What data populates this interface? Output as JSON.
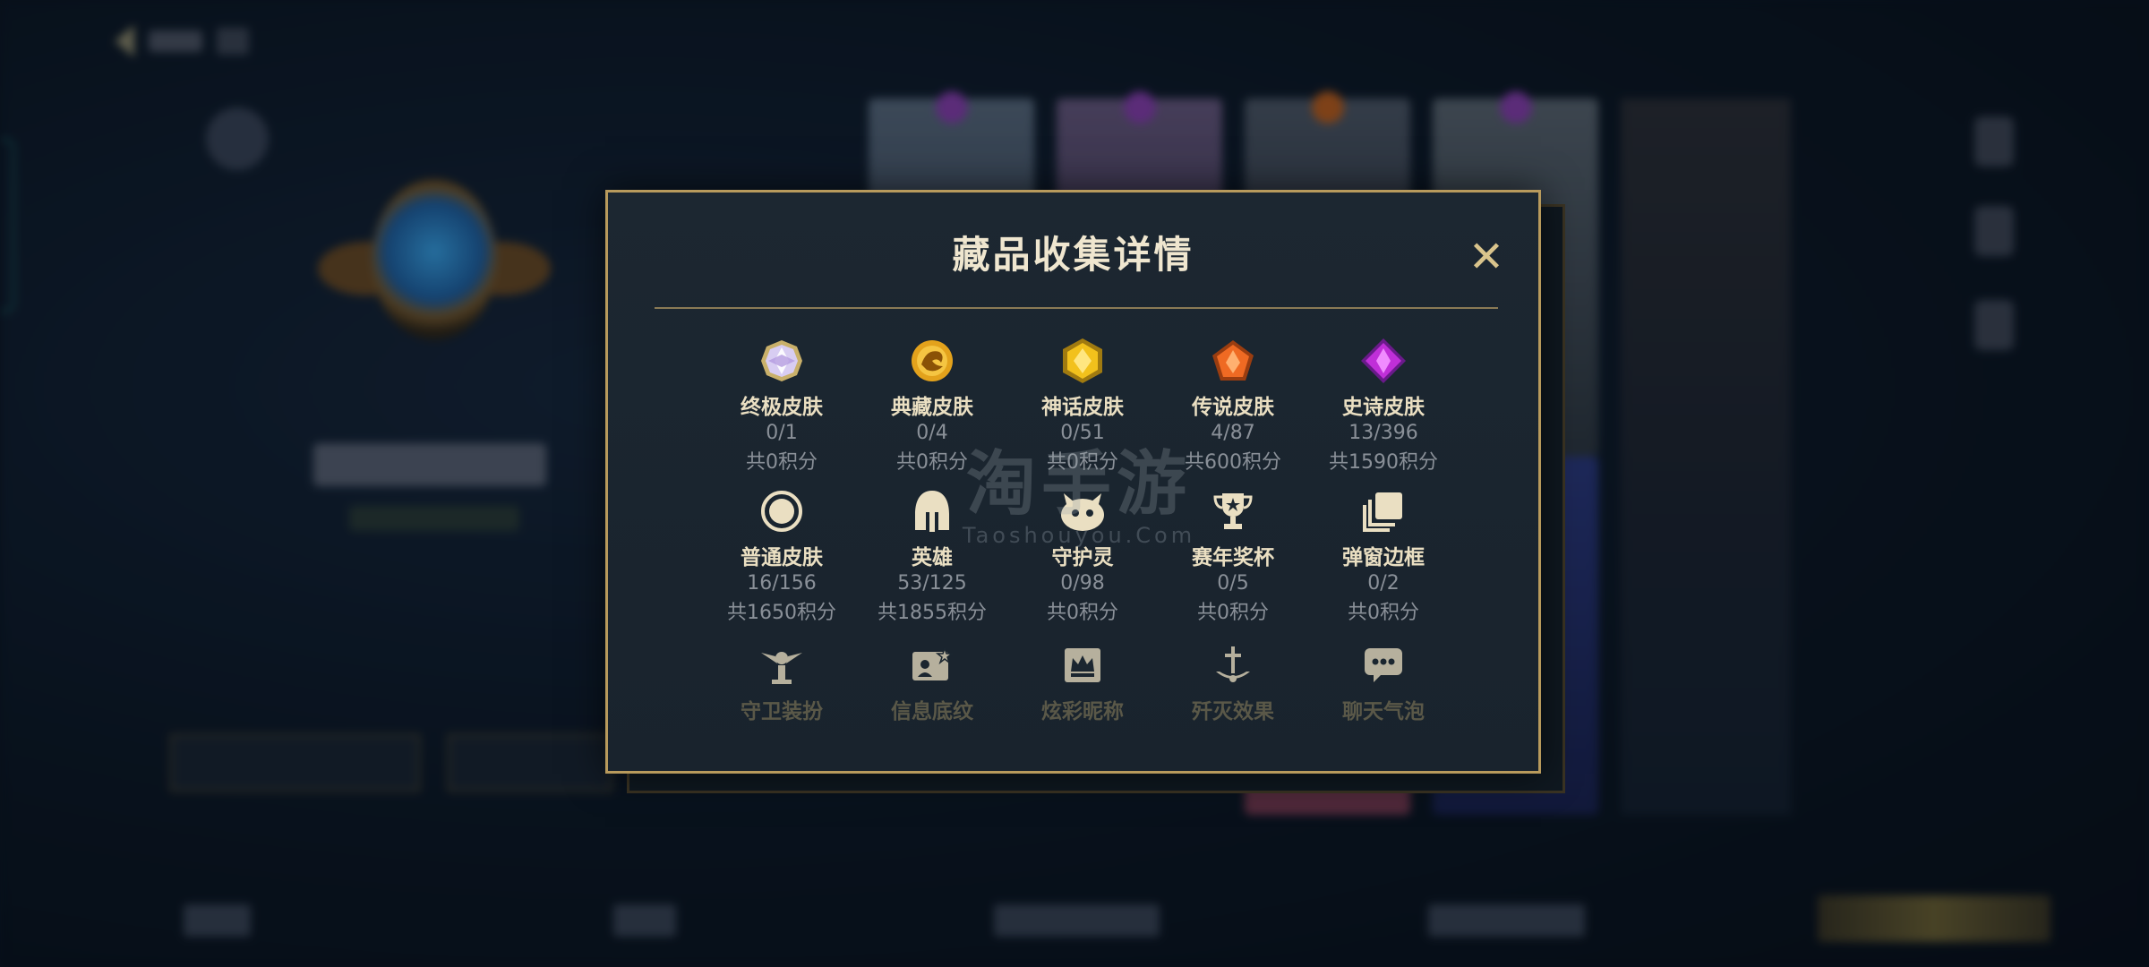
{
  "modal": {
    "title": "藏品收集详情",
    "close_glyph": "✕",
    "categories": [
      {
        "label": "终极皮肤",
        "count": "0/1",
        "score": "共0积分",
        "icon": "ultimate-gem-icon"
      },
      {
        "label": "典藏皮肤",
        "count": "0/4",
        "score": "共0积分",
        "icon": "prestige-dragon-icon"
      },
      {
        "label": "神话皮肤",
        "count": "0/51",
        "score": "共0积分",
        "icon": "mythic-gem-icon"
      },
      {
        "label": "传说皮肤",
        "count": "4/87",
        "score": "共600积分",
        "icon": "legendary-gem-icon"
      },
      {
        "label": "史诗皮肤",
        "count": "13/396",
        "score": "共1590积分",
        "icon": "epic-gem-icon"
      },
      {
        "label": "普通皮肤",
        "count": "16/156",
        "score": "共1650积分",
        "icon": "standard-ring-icon"
      },
      {
        "label": "英雄",
        "count": "53/125",
        "score": "共1855积分",
        "icon": "helmet-icon"
      },
      {
        "label": "守护灵",
        "count": "0/98",
        "score": "共0积分",
        "icon": "guardian-pet-icon"
      },
      {
        "label": "赛年奖杯",
        "count": "0/5",
        "score": "共0积分",
        "icon": "trophy-icon"
      },
      {
        "label": "弹窗边框",
        "count": "0/2",
        "score": "共0积分",
        "icon": "frame-stack-icon"
      },
      {
        "label": "守卫装扮",
        "icon": "ward-icon"
      },
      {
        "label": "信息底纹",
        "icon": "banner-card-icon"
      },
      {
        "label": "炫彩昵称",
        "icon": "crown-name-icon"
      },
      {
        "label": "歼灭效果",
        "icon": "sword-effect-icon"
      },
      {
        "label": "聊天气泡",
        "icon": "chat-bubble-icon"
      }
    ]
  },
  "watermark": {
    "main": "淘手游",
    "sub": "Taoshouyou.Com"
  },
  "colors": {
    "border_gold": "#b89a5c",
    "label": "#eadfc2",
    "muted": "#8a9098"
  }
}
